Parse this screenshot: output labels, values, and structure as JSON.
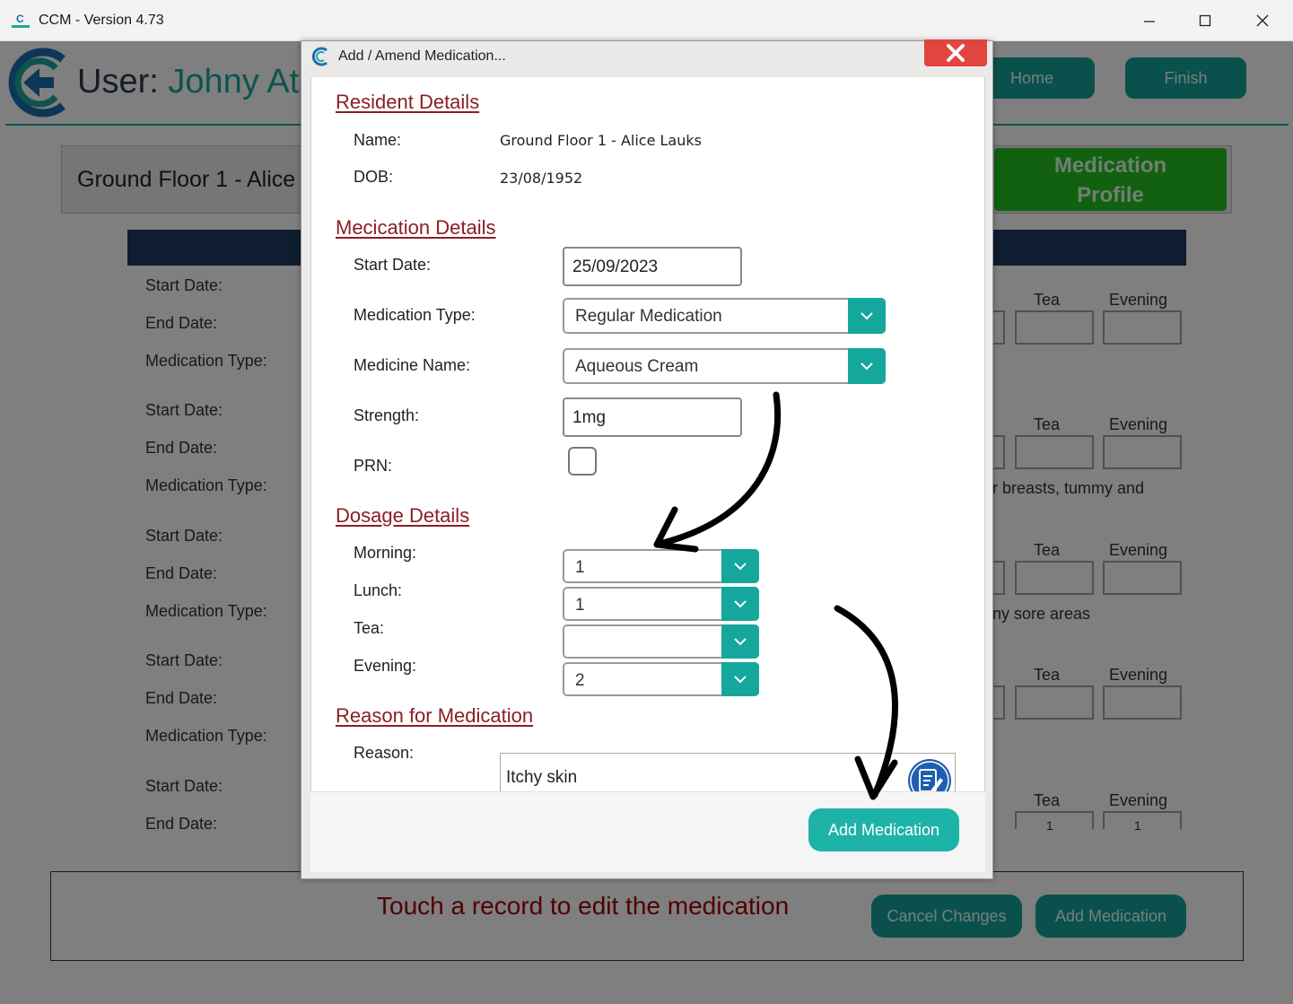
{
  "window": {
    "title": "CCM - Version 4.73"
  },
  "background": {
    "user_prefix": "User:",
    "user_name": "Johny At",
    "home_button": "Home",
    "finish_button": "Finish",
    "resident_name": "Ground Floor 1 - Alice",
    "medication_profile": [
      "Medication",
      "Profile"
    ],
    "row_labels": {
      "start": "Start Date:",
      "end": "End Date:",
      "type": "Medication Type:"
    },
    "col_tea": "Tea",
    "col_evening": "Evening",
    "note_1": "r breasts, tummy and",
    "note_2": "ny sore areas",
    "last_tea_value": "1",
    "last_evening_value": "1",
    "touch_message": "Touch a record to edit the medication",
    "cancel_button": "Cancel Changes",
    "add_button": "Add Medication"
  },
  "dialog": {
    "title": "Add / Amend Medication...",
    "resident_section": "Resident Details",
    "name_label": "Name:",
    "name_value": "Ground Floor 1 - Alice Lauks",
    "dob_label": "DOB:",
    "dob_value": "23/08/1952",
    "medication_section": "Mecication Details",
    "start_label": "Start Date:",
    "start_value": "25/09/2023",
    "type_label": "Medication Type:",
    "type_value": "Regular Medication",
    "medicine_label": "Medicine Name:",
    "medicine_value": "Aqueous Cream",
    "strength_label": "Strength:",
    "strength_value": "1mg",
    "prn_label": "PRN:",
    "prn_checked": false,
    "dosage_section": "Dosage Details",
    "morning_label": "Morning:",
    "morning_value": "1",
    "lunch_label": "Lunch:",
    "lunch_value": "1",
    "tea_label": "Tea:",
    "tea_value": "",
    "evening_label": "Evening:",
    "evening_value": "2",
    "reason_section": "Reason for Medication",
    "reason_label": "Reason:",
    "reason_value": "Itchy skin",
    "add_button": "Add Medication"
  },
  "colors": {
    "teal": "#15a79c",
    "section_red": "#8b1f23",
    "close_red": "#e0463d",
    "navy": "#1f3b63",
    "profile_green": "#22c222"
  }
}
